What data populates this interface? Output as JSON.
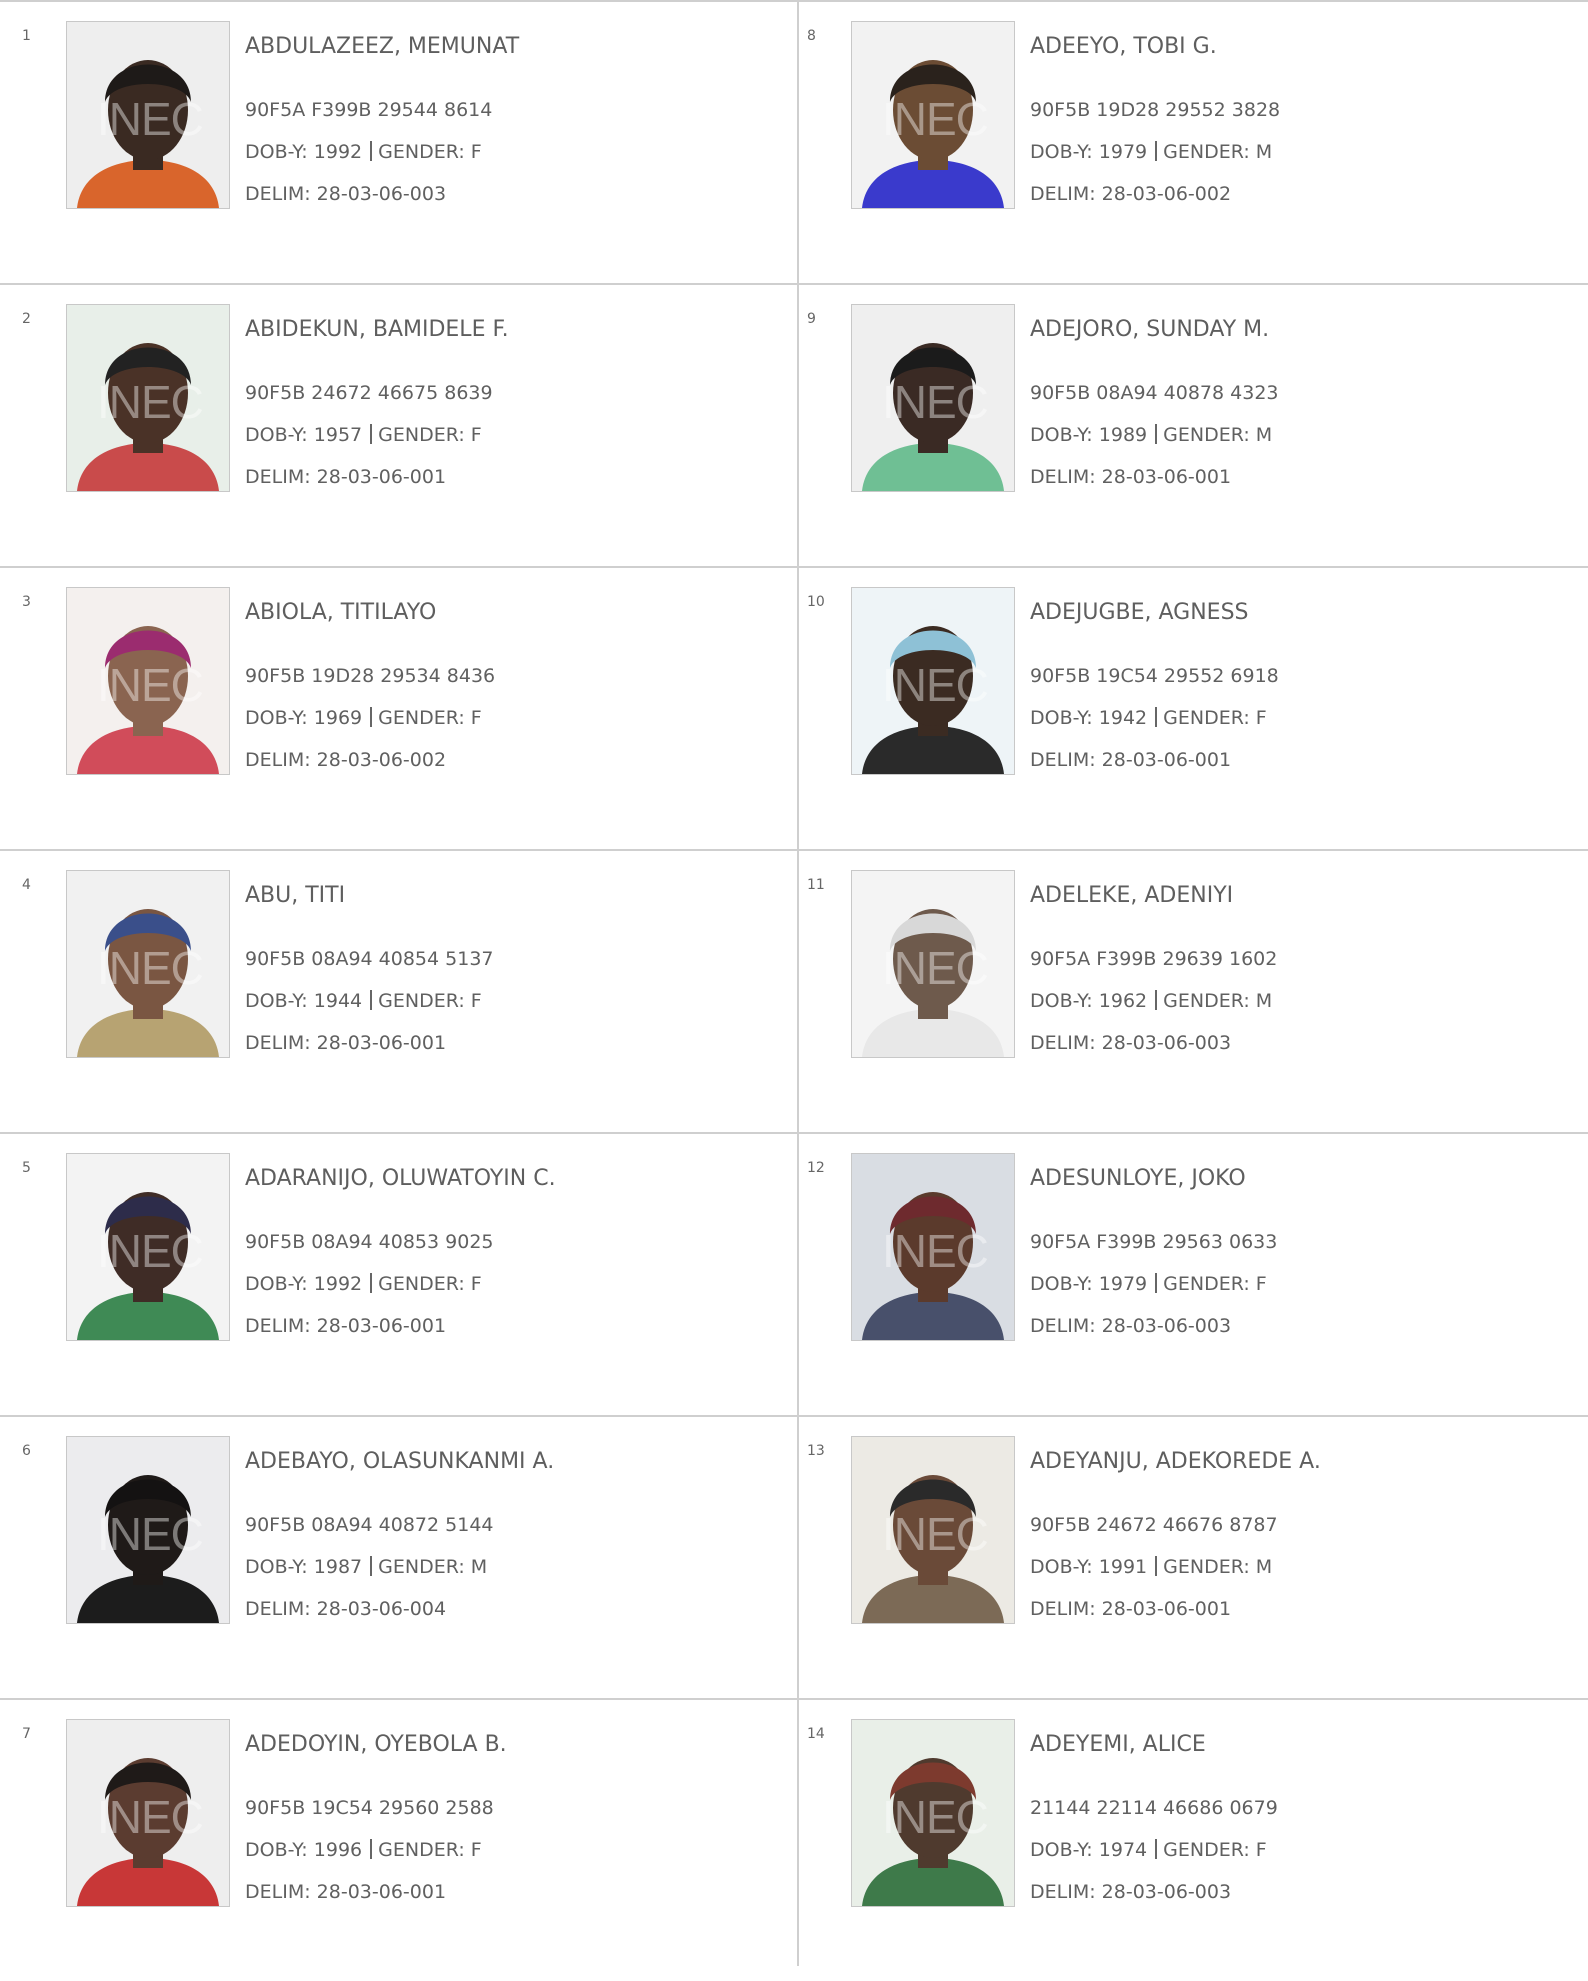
{
  "labels": {
    "dob": "DOB-Y:",
    "gender": "GENDER:",
    "delim": "DELIM:",
    "watermark": "INEC"
  },
  "entries": [
    {
      "serial": "1",
      "name": "ABDULAZEEZ, MEMUNAT",
      "vin": "90F5A F399B 29544 8614",
      "dob": "1992",
      "gender": "F",
      "delim": "28-03-06-003",
      "colors": {
        "bg": "#eeeeee",
        "skin": "#3a2a22",
        "hair": "#1e1a18",
        "cloth": "#d9652c"
      }
    },
    {
      "serial": "2",
      "name": "ABIDEKUN, BAMIDELE F.",
      "vin": "90F5B 24672 46675 8639",
      "dob": "1957",
      "gender": "F",
      "delim": "28-03-06-001",
      "colors": {
        "bg": "#e8efe9",
        "skin": "#4a3227",
        "hair": "#222222",
        "cloth": "#c94b4b"
      }
    },
    {
      "serial": "3",
      "name": "ABIOLA, TITILAYO",
      "vin": "90F5B 19D28 29534 8436",
      "dob": "1969",
      "gender": "F",
      "delim": "28-03-06-002",
      "colors": {
        "bg": "#f4f0ee",
        "skin": "#8a6450",
        "hair": "#9b2c6f",
        "cloth": "#d14c5a"
      }
    },
    {
      "serial": "4",
      "name": "ABU, TITI",
      "vin": "90F5B 08A94 40854 5137",
      "dob": "1944",
      "gender": "F",
      "delim": "28-03-06-001",
      "colors": {
        "bg": "#f1f1f1",
        "skin": "#7a5642",
        "hair": "#3a4f8a",
        "cloth": "#b7a372"
      }
    },
    {
      "serial": "5",
      "name": "ADARANIJO, OLUWATOYIN C.",
      "vin": "90F5B 08A94 40853 9025",
      "dob": "1992",
      "gender": "F",
      "delim": "28-03-06-001",
      "colors": {
        "bg": "#f3f3f3",
        "skin": "#3f2c26",
        "hair": "#2d2c4a",
        "cloth": "#3f8a55"
      }
    },
    {
      "serial": "6",
      "name": "ADEBAYO, OLASUNKANMI A.",
      "vin": "90F5B 08A94 40872 5144",
      "dob": "1987",
      "gender": "M",
      "delim": "28-03-06-004",
      "colors": {
        "bg": "#ececee",
        "skin": "#1f1a18",
        "hair": "#141212",
        "cloth": "#1c1c1c"
      }
    },
    {
      "serial": "7",
      "name": "ADEDOYIN, OYEBOLA B.",
      "vin": "90F5B 19C54 29560 2588",
      "dob": "1996",
      "gender": "F",
      "delim": "28-03-06-001",
      "colors": {
        "bg": "#eeeeee",
        "skin": "#5b3c30",
        "hair": "#1f1a18",
        "cloth": "#c83737"
      }
    },
    {
      "serial": "8",
      "name": "ADEEYO, TOBI G.",
      "vin": "90F5B 19D28 29552 3828",
      "dob": "1979",
      "gender": "M",
      "delim": "28-03-06-002",
      "colors": {
        "bg": "#f2f2f2",
        "skin": "#6b4c34",
        "hair": "#2a221c",
        "cloth": "#3a3acc"
      }
    },
    {
      "serial": "9",
      "name": "ADEJORO, SUNDAY M.",
      "vin": "90F5B 08A94 40878 4323",
      "dob": "1989",
      "gender": "M",
      "delim": "28-03-06-001",
      "colors": {
        "bg": "#efefef",
        "skin": "#3a2a24",
        "hair": "#1b1b1b",
        "cloth": "#6fbf94"
      }
    },
    {
      "serial": "10",
      "name": "ADEJUGBE, AGNESS",
      "vin": "90F5B 19C54 29552 6918",
      "dob": "1942",
      "gender": "F",
      "delim": "28-03-06-001",
      "colors": {
        "bg": "#eef4f7",
        "skin": "#3b2b22",
        "hair": "#8ec1d6",
        "cloth": "#2a2a2a"
      }
    },
    {
      "serial": "11",
      "name": "ADELEKE, ADENIYI",
      "vin": "90F5A F399B 29639 1602",
      "dob": "1962",
      "gender": "M",
      "delim": "28-03-06-003",
      "colors": {
        "bg": "#f4f4f4",
        "skin": "#6e5a4c",
        "hair": "#d8d8d8",
        "cloth": "#e8e8e8"
      }
    },
    {
      "serial": "12",
      "name": "ADESUNLOYE, JOKO",
      "vin": "90F5A F399B 29563 0633",
      "dob": "1979",
      "gender": "F",
      "delim": "28-03-06-003",
      "colors": {
        "bg": "#d9dde3",
        "skin": "#5b3a2c",
        "hair": "#6e2a2e",
        "cloth": "#48506b"
      }
    },
    {
      "serial": "13",
      "name": "ADEYANJU, ADEKOREDE A.",
      "vin": "90F5B 24672 46676 8787",
      "dob": "1991",
      "gender": "M",
      "delim": "28-03-06-001",
      "colors": {
        "bg": "#eceae4",
        "skin": "#6a4a38",
        "hair": "#2a2a2a",
        "cloth": "#7c6a56"
      }
    },
    {
      "serial": "14",
      "name": "ADEYEMI, ALICE",
      "vin": "21144 22114 46686 0679",
      "dob": "1974",
      "gender": "F",
      "delim": "28-03-06-003",
      "colors": {
        "bg": "#e9efe8",
        "skin": "#4f3a2e",
        "hair": "#7d3a2e",
        "cloth": "#3e7a4a"
      }
    }
  ]
}
